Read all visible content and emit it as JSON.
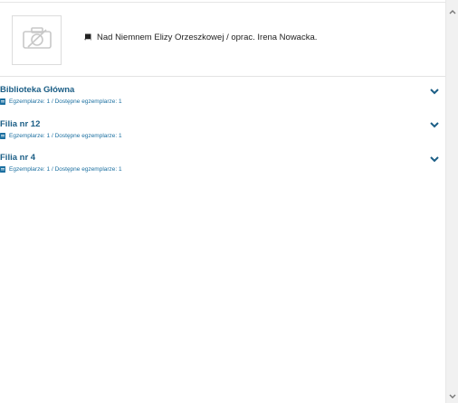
{
  "record": {
    "title": "Nad Niemnem Elizy Orzeszkowej / oprac. Irena Nowacka."
  },
  "libraries": [
    {
      "name": "Biblioteka Główna",
      "availability": "Egzemplarze: 1 / Dostępne egzemplarze: 1"
    },
    {
      "name": "Filia nr 12",
      "availability": "Egzemplarze: 1 / Dostępne egzemplarze: 1"
    },
    {
      "name": "Filia nr 4",
      "availability": "Egzemplarze: 1 / Dostępne egzemplarze: 1"
    }
  ],
  "icons": {
    "thumbnail": "camera-icon",
    "title": "book-icon",
    "availability": "document-icon",
    "expand": "chevron-down-icon"
  },
  "colors": {
    "accent": "#1b5e86",
    "link": "#1b6fa0",
    "icon_gray": "#c8c8c8"
  }
}
